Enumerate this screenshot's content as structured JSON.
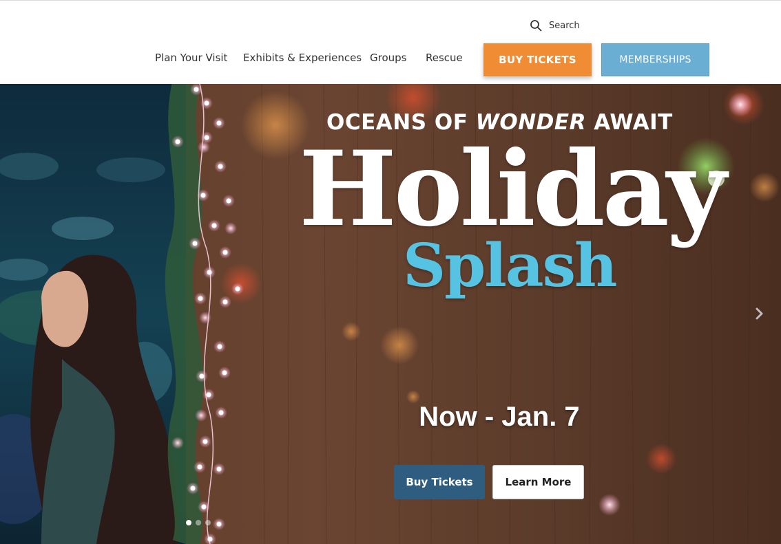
{
  "header": {
    "search_label": "Search",
    "nav": [
      {
        "label": "Plan Your Visit"
      },
      {
        "label": "Exhibits & Experiences"
      },
      {
        "label": "Groups"
      },
      {
        "label": "Rescue"
      }
    ],
    "buy_tickets_label": "BUY TICKETS",
    "memberships_label": "MEMBERSHIPS"
  },
  "hero": {
    "tagline_part1": "OCEANS OF ",
    "tagline_part2": "WONDER",
    "tagline_part3": " AWAIT",
    "title": "Holiday",
    "subtitle": "Splash",
    "dates": "Now - Jan. 7",
    "cta_primary": "Buy Tickets",
    "cta_secondary": "Learn More",
    "slide_count": 3,
    "active_slide": 1
  },
  "colors": {
    "buy_tickets": "#f08c34",
    "memberships": "#6aaed3",
    "cta_primary": "#2f5d7f",
    "subtitle": "#57c3e3"
  }
}
